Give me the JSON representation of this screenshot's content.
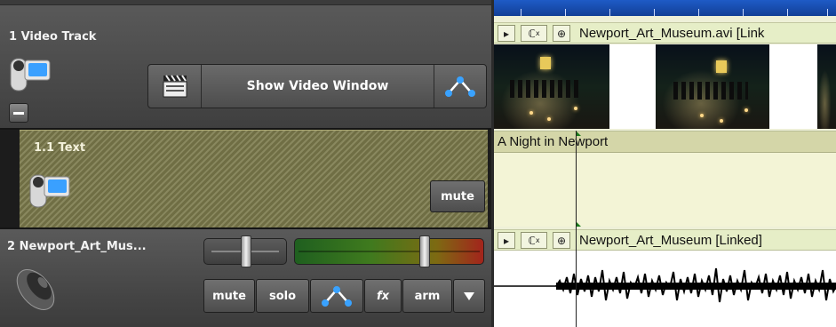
{
  "tracks": {
    "video": {
      "number": "1",
      "title": "1 Video Track",
      "show_video_window": "Show Video Window"
    },
    "text": {
      "title": "1.1 Text",
      "mute": "mute"
    },
    "audio": {
      "title": "2 Newport_Art_Mus...",
      "buttons": {
        "mute": "mute",
        "solo": "solo",
        "fx": "fx",
        "arm": "arm"
      },
      "pan_value": 0.5,
      "volume_value": 0.72
    }
  },
  "timeline": {
    "video_clip": {
      "name": "Newport_Art_Museum.avi [Link"
    },
    "text_clip": {
      "name": "A Night in Newport"
    },
    "audio_clip": {
      "name": "Newport_Art_Museum [Linked]"
    }
  },
  "colors": {
    "text_track": "#7c7a4c",
    "ruler": "#1e5bc6",
    "clip_header": "#e6eec7"
  },
  "icons": [
    "camera-icon",
    "minus-icon",
    "clapperboard-icon",
    "envelope-icon",
    "speaker-icon",
    "dropdown-arrow-icon",
    "play-icon",
    "fx-clip-icon",
    "crop-clip-icon"
  ]
}
